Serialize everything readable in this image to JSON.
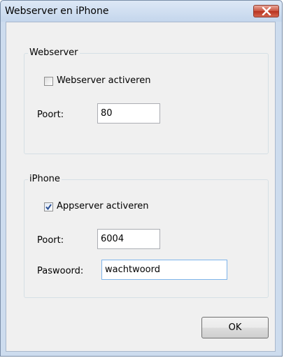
{
  "window": {
    "title": "Webserver en iPhone",
    "close_icon": "close-x-icon"
  },
  "webserver_group": {
    "label": "Webserver",
    "checkbox_label": "Webserver activeren",
    "checkbox_checked": false,
    "port_label": "Poort:",
    "port_value": "80"
  },
  "iphone_group": {
    "label": "iPhone",
    "checkbox_label": "Appserver activeren",
    "checkbox_checked": true,
    "port_label": "Poort:",
    "port_value": "6004",
    "password_label": "Paswoord:",
    "password_value": "wachtwoord"
  },
  "buttons": {
    "ok_label": "OK"
  },
  "colors": {
    "close_button": "#c9503d",
    "checkmark": "#2a4f95",
    "title_bar": "#cddcee"
  }
}
